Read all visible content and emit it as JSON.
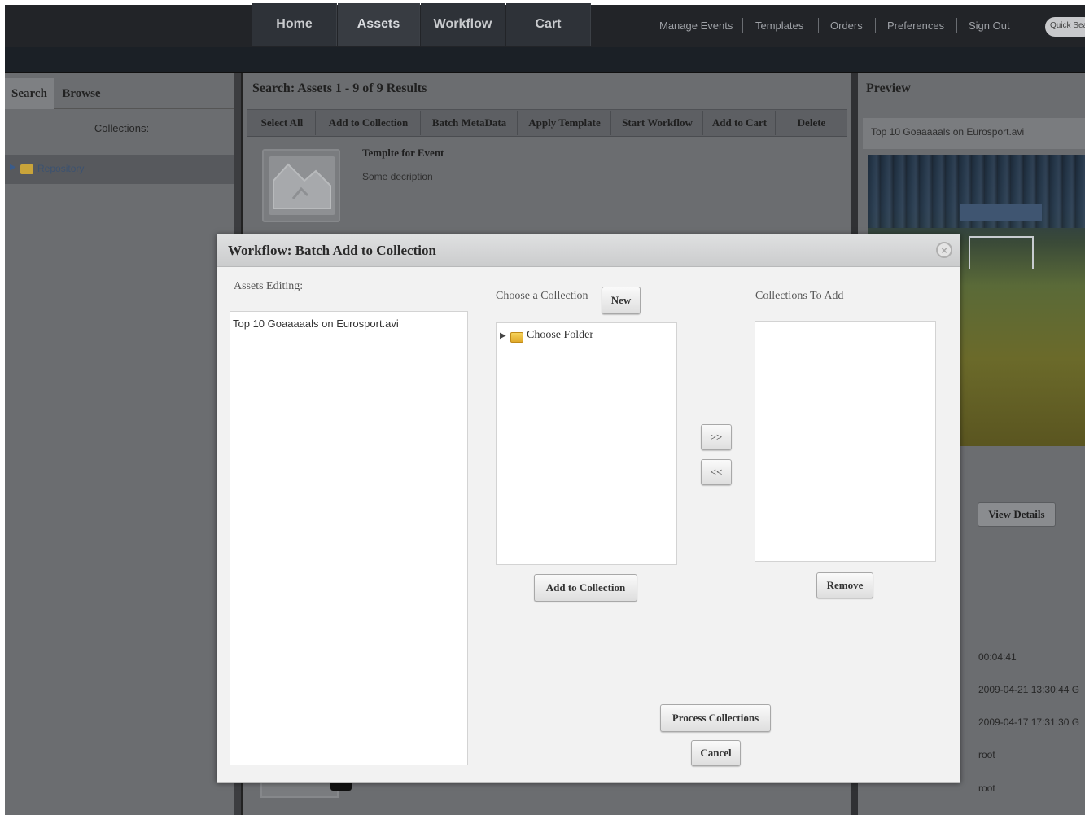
{
  "nav": {
    "tabs": [
      "Home",
      "Assets",
      "Workflow",
      "Cart"
    ],
    "links": [
      "Manage Events",
      "Templates",
      "Orders",
      "Preferences",
      "Sign Out"
    ],
    "quick_search": "Quick Sea"
  },
  "left_panel": {
    "tabs": [
      "Search",
      "Browse"
    ],
    "collections_label": "Collections:",
    "tree_root": "Repository"
  },
  "center_panel": {
    "title": "Search: Assets 1 - 9 of 9 Results",
    "toolbar": [
      "Select All",
      "Add to Collection",
      "Batch MetaData",
      "Apply Template",
      "Start Workflow",
      "Add to Cart",
      "Delete"
    ],
    "asset_title": "Templte for Event",
    "asset_description": "Some decription"
  },
  "right_panel": {
    "title": "Preview",
    "filename": "Top 10 Goaaaaals on Eurosport.avi",
    "view_details": "View Details",
    "meta_values": [
      "00:04:41",
      "2009-04-21 13:30:44 G",
      "2009-04-17 17:31:30 G",
      "root",
      "root"
    ]
  },
  "modal": {
    "title": "Workflow: Batch Add to Collection",
    "close_symbol": "×",
    "assets_label": "Assets Editing:",
    "asset_item": "Top 10 Goaaaaals on Eurosport.avi",
    "choose_label": "Choose a Collection",
    "new_button": "New",
    "folder_label": "Choose Folder",
    "collections_label": "Collections To Add",
    "move_right": ">>",
    "move_left": "<<",
    "add_button": "Add to Collection",
    "remove_button": "Remove",
    "process_button": "Process Collections",
    "cancel_button": "Cancel"
  }
}
